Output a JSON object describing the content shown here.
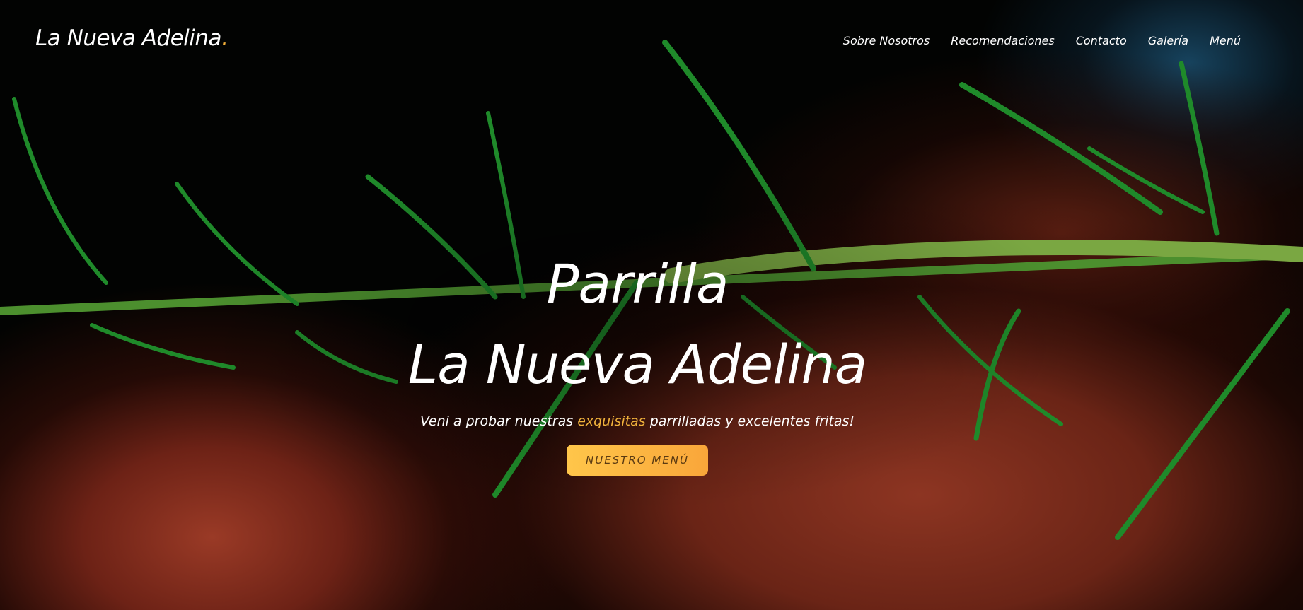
{
  "brand": {
    "name": "La Nueva Adelina",
    "dot": ".",
    "accent_color": "#f6b23a"
  },
  "nav": {
    "items": [
      {
        "label": "Sobre Nosotros"
      },
      {
        "label": "Recomendaciones"
      },
      {
        "label": "Contacto"
      },
      {
        "label": "Galería"
      },
      {
        "label": "Menú"
      }
    ]
  },
  "hero": {
    "title_line1": "Parrilla",
    "title_line2": "La Nueva Adelina",
    "subtitle_before": "Veni a probar nuestras ",
    "subtitle_accent": "exquisitas",
    "subtitle_after": " parrilladas y excelentes fritas!",
    "cta_label": "NUESTRO MENÚ",
    "cta_colors": [
      "#ffc64a",
      "#f9a63a"
    ],
    "background_image": "grilled steak with rosemary sprig"
  }
}
